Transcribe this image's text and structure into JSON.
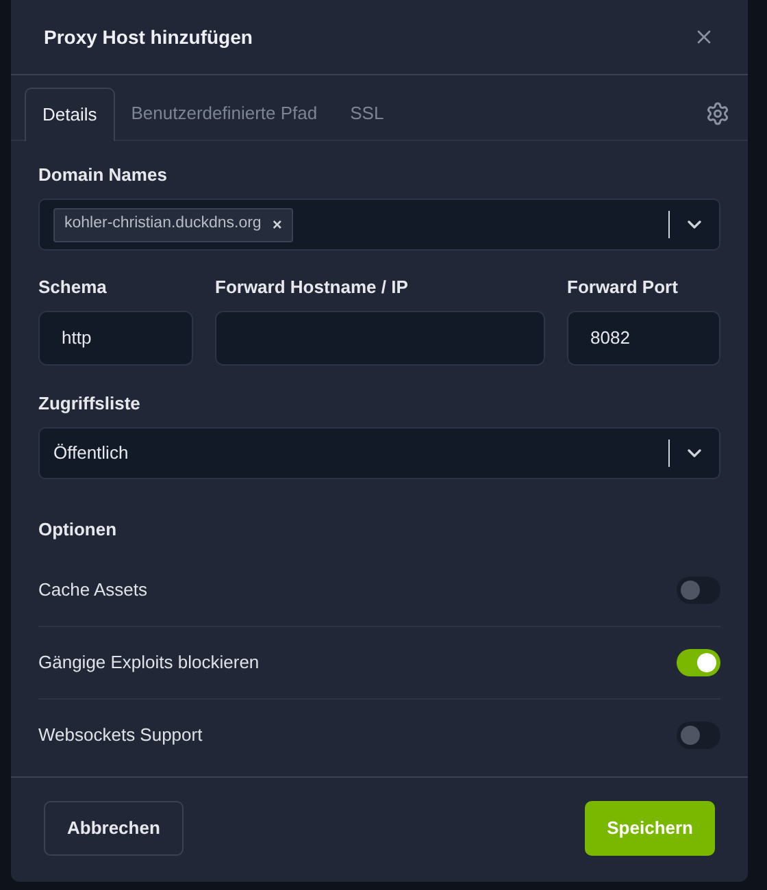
{
  "dialog": {
    "title": "Proxy Host hinzufügen"
  },
  "tabs": [
    {
      "label": "Details",
      "selected": true
    },
    {
      "label": "Benutzerdefinierte Pfad",
      "selected": false
    },
    {
      "label": "SSL",
      "selected": false
    }
  ],
  "domain_names": {
    "label": "Domain Names",
    "tags": [
      "kohler-christian.duckdns.org"
    ],
    "tag_remove": "×"
  },
  "schema": {
    "label": "Schema",
    "value": "http"
  },
  "forward_host": {
    "label": "Forward Hostname / IP"
  },
  "forward_port": {
    "label": "Forward Port",
    "value": "8082"
  },
  "access_list": {
    "label": "Zugriffsliste",
    "value": "Öffentlich"
  },
  "options": {
    "heading": "Optionen",
    "items": [
      {
        "label": "Cache Assets",
        "on": false
      },
      {
        "label": "Gängige Exploits blockieren",
        "on": true
      },
      {
        "label": "Websockets Support",
        "on": false
      }
    ]
  },
  "buttons": {
    "cancel": "Abbrechen",
    "save": "Speichern"
  }
}
